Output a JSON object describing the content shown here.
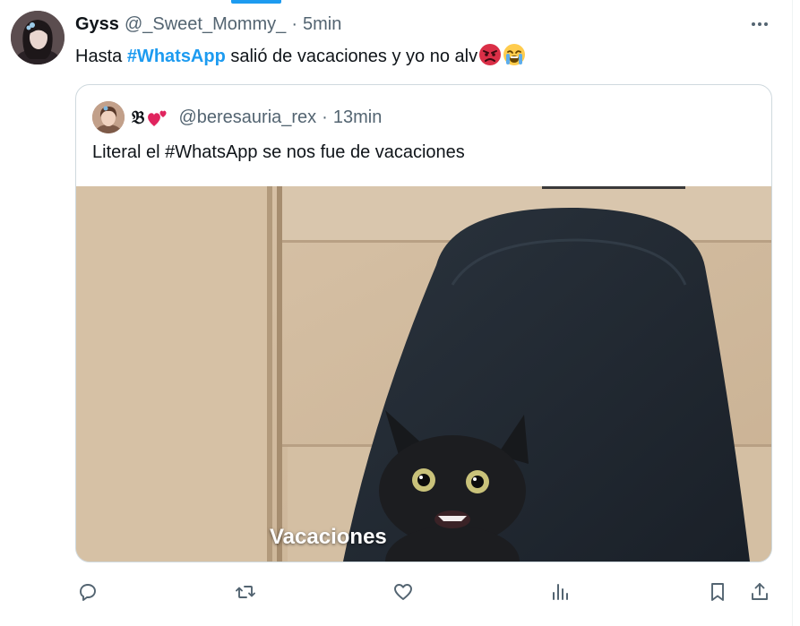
{
  "tweet": {
    "author_name": "Gyss",
    "handle": "@_Sweet_Mommy_",
    "separator": "·",
    "time": "5min",
    "text_prefix": "Hasta ",
    "hashtag": "#WhatsApp",
    "text_suffix": " salió de vacaciones y yo no alv",
    "emojis": [
      "angry-face-emoji",
      "loudly-crying-face-emoji"
    ]
  },
  "quoted": {
    "author_name": "𝔅",
    "heart_icon": "two-hearts-emoji",
    "handle": "@beresauria_rex",
    "separator": "·",
    "time": "13min",
    "text": "Literal el  #WhatsApp se nos fue de vacaciones",
    "media": {
      "caption": "Vacaciones",
      "subject": "black-kitten-on-chair"
    }
  },
  "actions": [
    {
      "icon": "reply-icon"
    },
    {
      "icon": "retweet-icon"
    },
    {
      "icon": "like-icon"
    },
    {
      "icon": "views-icon"
    },
    {
      "icon": "bookmark-icon"
    },
    {
      "icon": "share-icon"
    }
  ],
  "colors": {
    "accent": "#1d9bf0",
    "text": "#0f1419",
    "secondary": "#536471",
    "border": "#cfd9de"
  }
}
